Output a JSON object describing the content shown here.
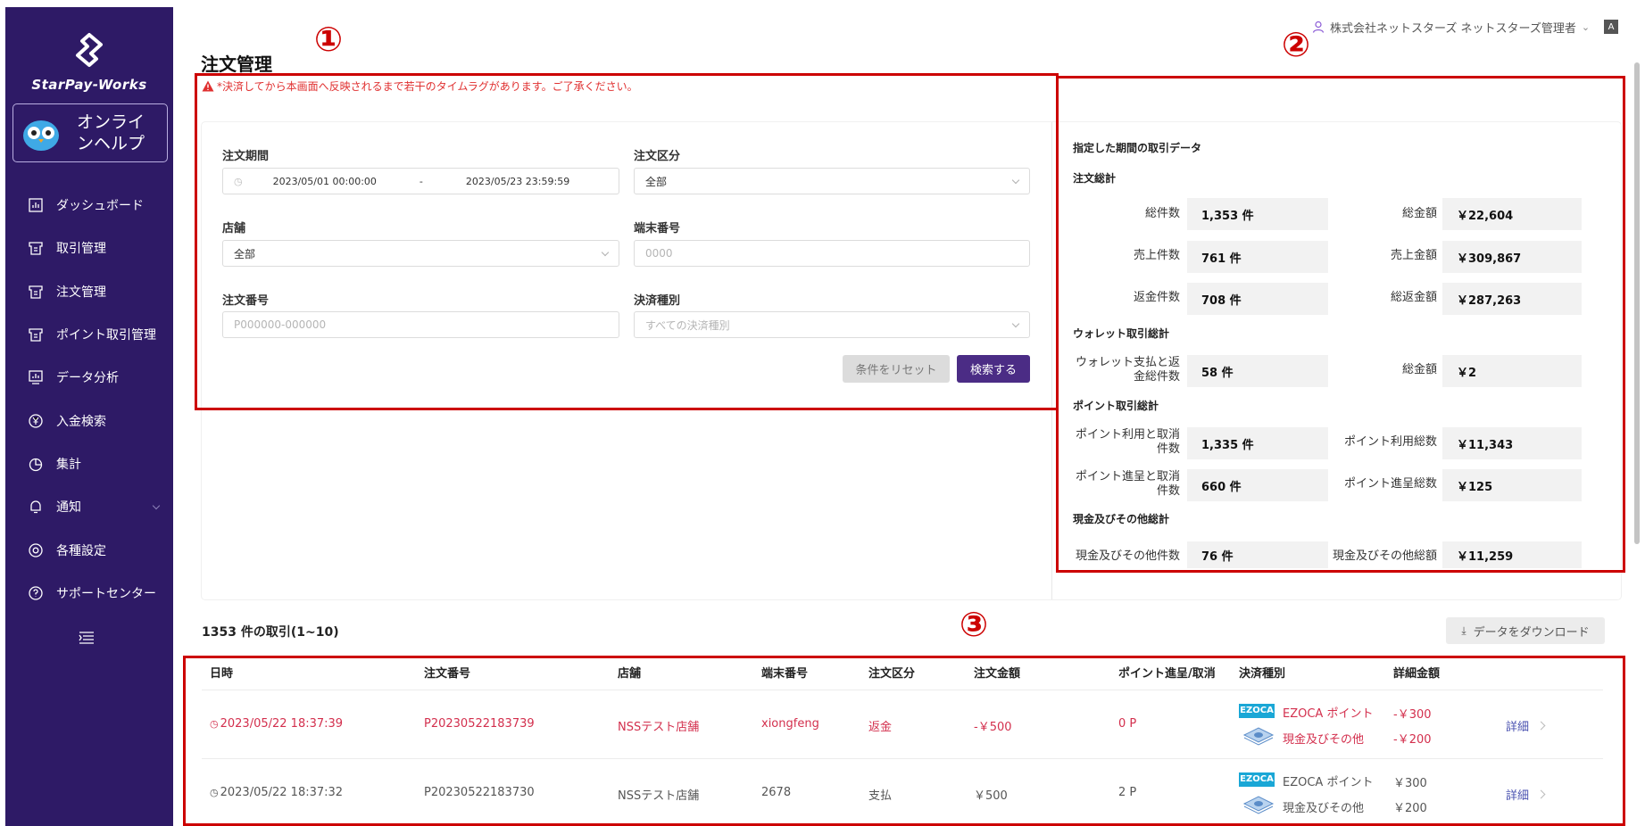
{
  "sidebar": {
    "brand": "StarPay-Works",
    "help_label": "オンラインヘルプ",
    "items": [
      {
        "label": "ダッシュボード"
      },
      {
        "label": "取引管理"
      },
      {
        "label": "注文管理"
      },
      {
        "label": "ポイント取引管理"
      },
      {
        "label": "データ分析"
      },
      {
        "label": "入金検索"
      },
      {
        "label": "集計"
      },
      {
        "label": "通知"
      },
      {
        "label": "各種設定"
      },
      {
        "label": "サポートセンター"
      }
    ]
  },
  "header": {
    "user": "株式会社ネットスターズ ネットスターズ管理者",
    "lang_icon_text": "A"
  },
  "page": {
    "title": "注文管理",
    "warning": "*決済してから本画面へ反映されるまで若干のタイムラグがあります。ご了承ください。"
  },
  "annotations": [
    "①",
    "②",
    "③"
  ],
  "filters": {
    "period_label": "注文期間",
    "period_start": "2023/05/01 00:00:00",
    "period_sep": "-",
    "period_end": "2023/05/23 23:59:59",
    "order_type_label": "注文区分",
    "order_type_value": "全部",
    "store_label": "店舗",
    "store_value": "全部",
    "terminal_label": "端末番号",
    "terminal_placeholder": "0000",
    "order_no_label": "注文番号",
    "order_no_placeholder": "P000000-000000",
    "payment_label": "決済種別",
    "payment_placeholder": "すべての決済種別",
    "reset_label": "条件をリセット",
    "search_label": "検索する"
  },
  "stats": {
    "heading": "指定した期間の取引データ",
    "order_total": "注文総計",
    "total_count_label": "総件数",
    "total_count": "1,353 件",
    "total_amount_label": "総金額",
    "total_amount": "￥22,604",
    "sales_count_label": "売上件数",
    "sales_count": "761 件",
    "sales_amount_label": "売上金額",
    "sales_amount": "￥309,867",
    "refund_count_label": "返金件数",
    "refund_count": "708 件",
    "refund_amount_label": "総返金額",
    "refund_amount": "￥287,263",
    "wallet_total": "ウォレット取引総計",
    "wallet_count_label": "ウォレット支払と返金総件数",
    "wallet_count": "58 件",
    "wallet_amount_label": "総金額",
    "wallet_amount": "￥2",
    "point_total": "ポイント取引総計",
    "point_use_label": "ポイント利用と取消件数",
    "point_use_count": "1,335 件",
    "point_use_amount_label": "ポイント利用総数",
    "point_use_amount": "￥11,343",
    "point_give_label": "ポイント進呈と取消件数",
    "point_give_count": "660 件",
    "point_give_amount_label": "ポイント進呈総数",
    "point_give_amount": "￥125",
    "cash_total": "現金及びその他総計",
    "cash_count_label": "現金及びその他件数",
    "cash_count": "76 件",
    "cash_amount_label": "現金及びその他総額",
    "cash_amount": "￥11,259"
  },
  "table": {
    "count_label": "1353 件の取引(1~10)",
    "download_label": "データをダウンロード",
    "headers": [
      "日時",
      "注文番号",
      "店舗",
      "端末番号",
      "注文区分",
      "注文金額",
      "ポイント進呈/取消",
      "決済種別",
      "詳細金額"
    ],
    "rows": [
      {
        "datetime": "2023/05/22 18:37:39",
        "order_no": "P20230522183739",
        "store": "NSSテスト店舗",
        "terminal": "xiongfeng",
        "type": "返金",
        "amount": "-￥500",
        "points": "0 P",
        "pay1_badge": "EZOCA",
        "pay1": "EZOCA ポイント",
        "pay1_amount": "-￥300",
        "pay2": "現金及びその他",
        "pay2_amount": "-￥200",
        "detail": "詳細"
      },
      {
        "datetime": "2023/05/22 18:37:32",
        "order_no": "P20230522183730",
        "store": "NSSテスト店舗",
        "terminal": "2678",
        "type": "支払",
        "amount": "￥500",
        "points": "2 P",
        "pay1_badge": "EZOCA",
        "pay1": "EZOCA ポイント",
        "pay1_amount": "￥300",
        "pay2": "現金及びその他",
        "pay2_amount": "￥200",
        "detail": "詳細"
      }
    ]
  },
  "colors": {
    "sidebar": "#2e1a66",
    "accent": "#4b2c85",
    "refund": "#d32f4d",
    "annotation": "#cc0000"
  }
}
